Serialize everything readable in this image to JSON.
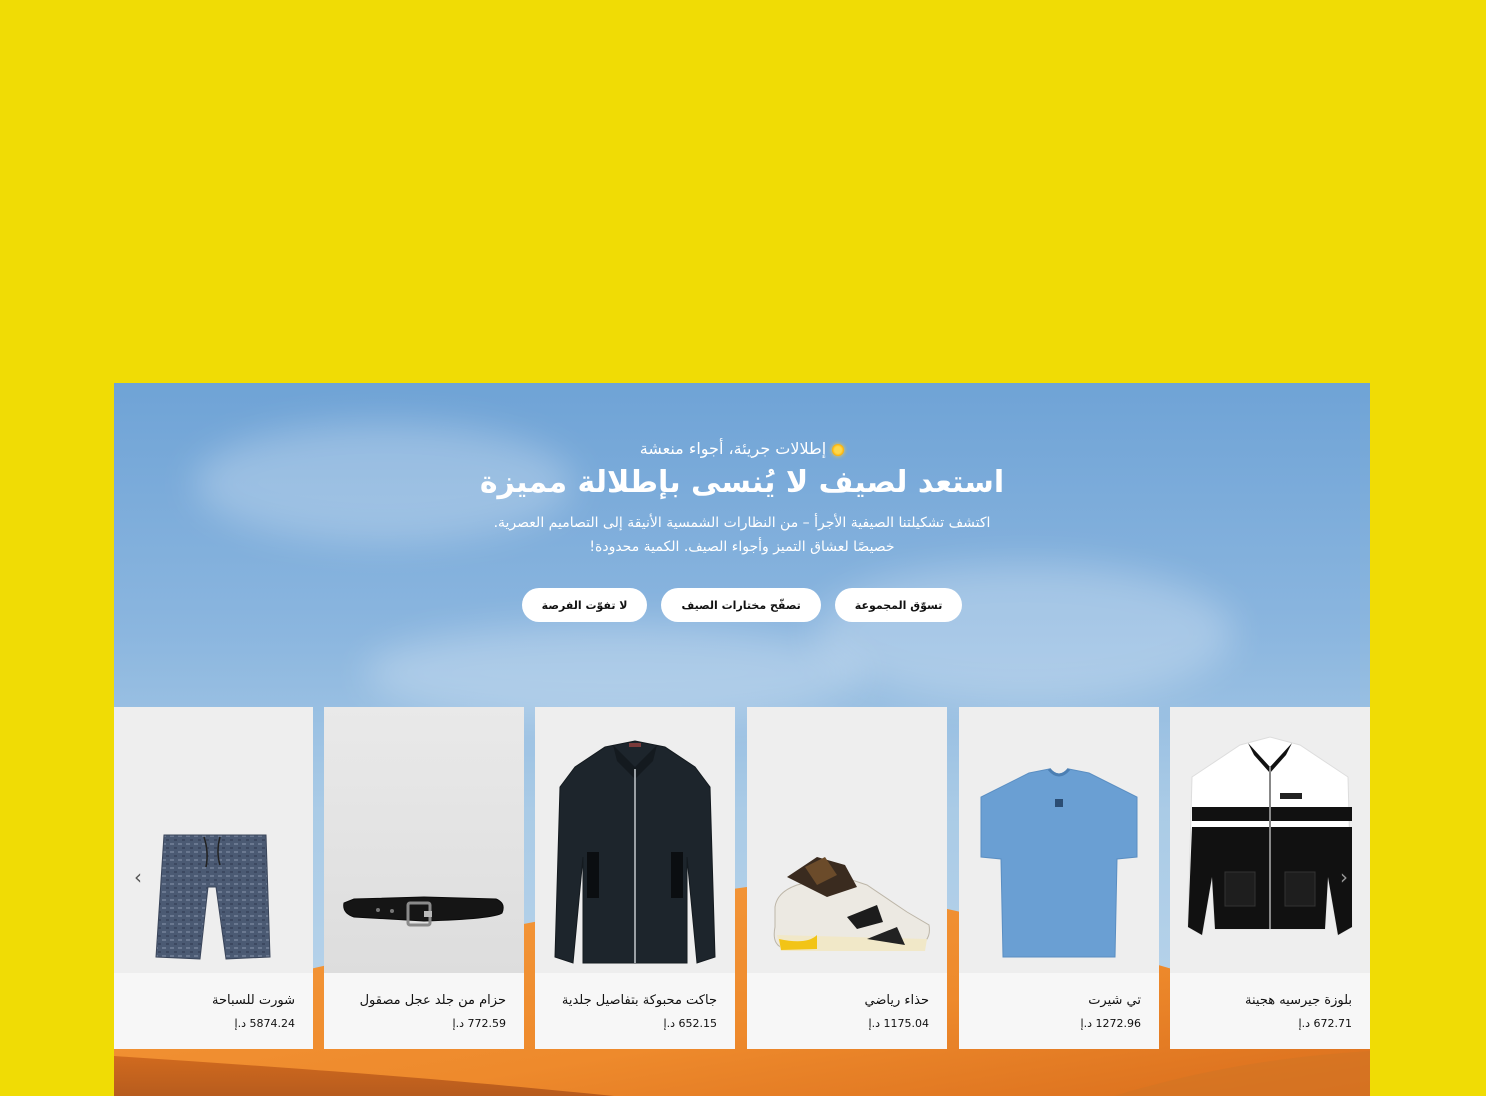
{
  "hero": {
    "eyebrow": "إطلالات جريئة، أجواء منعشة",
    "title": "استعد لصيف لا يُنسى بإطلالة مميزة",
    "desc_line1": "اكتشف تشكيلتنا الصيفية الأجرأ – من النظارات الشمسية الأنيقة إلى التصاميم العصرية.",
    "desc_line2": "خصيصًا لعشاق التميز وأجواء الصيف. الكمية محدودة!",
    "sun_icon": "sun-icon"
  },
  "buttons": [
    {
      "label": "تسوّق المجموعة"
    },
    {
      "label": "تصفّح مختارات الصيف"
    },
    {
      "label": "لا تفوّت الفرصة"
    }
  ],
  "products": [
    {
      "name": "بلوزة جيرسيه هجينة",
      "price": "672.71 د.إ"
    },
    {
      "name": "تي شيرت",
      "price": "1272.96 د.إ"
    },
    {
      "name": "حذاء رياضي",
      "price": "1175.04 د.إ"
    },
    {
      "name": "جاكت محبوكة بتفاصيل جلدية",
      "price": "652.15 د.إ"
    },
    {
      "name": "حزام من جلد عجل مصقول",
      "price": "772.59 د.إ"
    },
    {
      "name": "شورت للسباحة",
      "price": "5874.24 د.إ"
    }
  ],
  "nav": {
    "prev_icon": "chevron-left-icon",
    "next_icon": "chevron-right-icon"
  },
  "colors": {
    "page_bg": "#f0dc05",
    "sky": "#7fb0dd",
    "dune": "#f28a2e"
  }
}
